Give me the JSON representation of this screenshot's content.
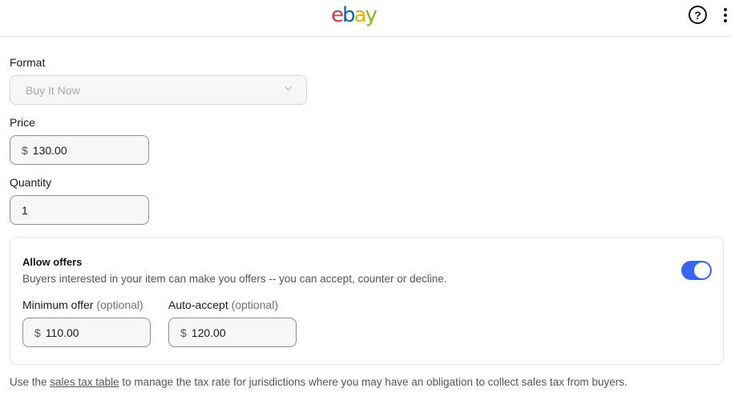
{
  "header": {
    "logo_letters": [
      "e",
      "b",
      "a",
      "y"
    ],
    "help_symbol": "?",
    "brand_colors": {
      "e": "#e53238",
      "b": "#0064d2",
      "a": "#f5af02",
      "y": "#86b817"
    }
  },
  "form": {
    "format": {
      "label": "Format",
      "value": "Buy It Now",
      "disabled": true
    },
    "price": {
      "label": "Price",
      "currency": "$",
      "value": "130.00"
    },
    "quantity": {
      "label": "Quantity",
      "value": "1"
    },
    "offers": {
      "title": "Allow offers",
      "description": "Buyers interested in your item can make you offers -- you can accept, counter or decline.",
      "enabled": true,
      "toggle_color": "#3665f3",
      "minimum": {
        "label": "Minimum offer",
        "optional": "(optional)",
        "currency": "$",
        "value": "110.00"
      },
      "auto_accept": {
        "label": "Auto-accept",
        "optional": "(optional)",
        "currency": "$",
        "value": "120.00"
      }
    }
  },
  "footer": {
    "text_before": "Use the ",
    "link_text": "sales tax table",
    "text_after": " to manage the tax rate for jurisdictions where you may have an obligation to collect sales tax from buyers."
  }
}
